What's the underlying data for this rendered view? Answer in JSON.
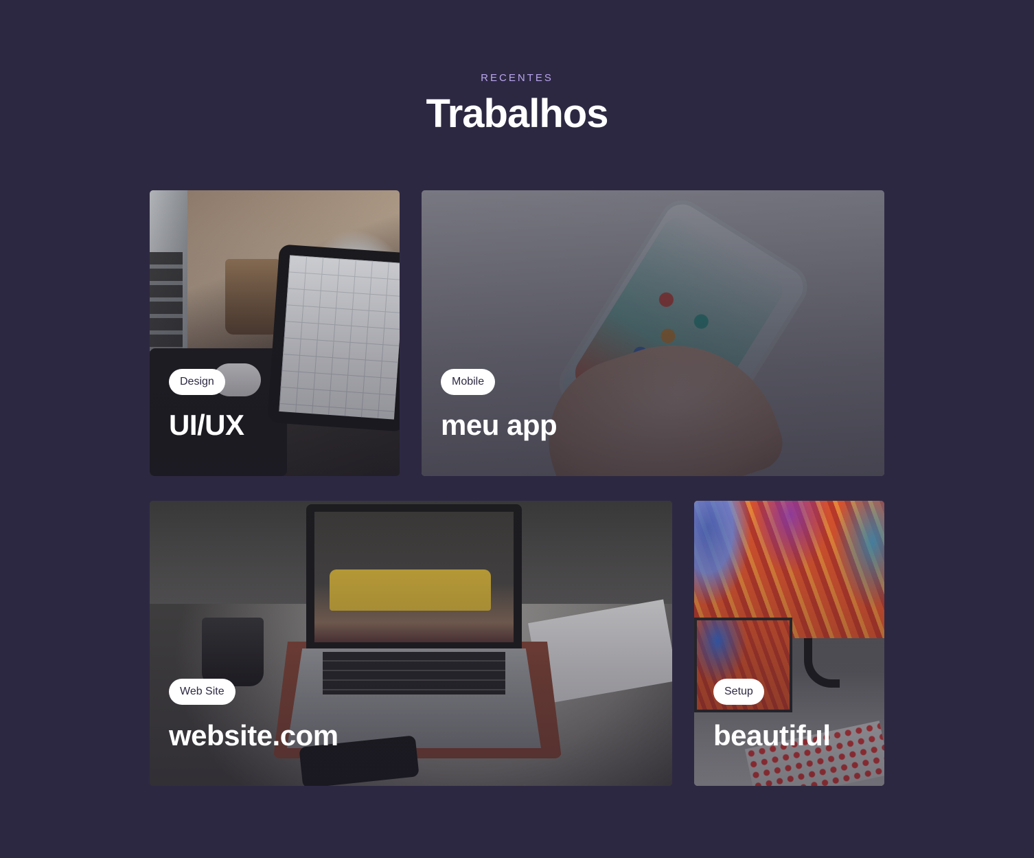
{
  "section": {
    "eyebrow": "RECENTES",
    "title": "Trabalhos"
  },
  "projects": [
    {
      "tag": "Design",
      "title": "UI/UX",
      "image": "desk-tablet-wireframe-photo"
    },
    {
      "tag": "Mobile",
      "title": "meu app",
      "image": "hand-holding-phone-photo"
    },
    {
      "tag": "Web Site",
      "title": "website.com",
      "image": "laptop-product-site-photo"
    },
    {
      "tag": "Setup",
      "title": "beautiful",
      "image": "monitor-setup-photo"
    }
  ],
  "colors": {
    "background": "#2d2842",
    "eyebrow": "#b9a6f0",
    "title": "#ffffff",
    "tag_background": "#ffffff",
    "tag_text": "#2d2842"
  }
}
